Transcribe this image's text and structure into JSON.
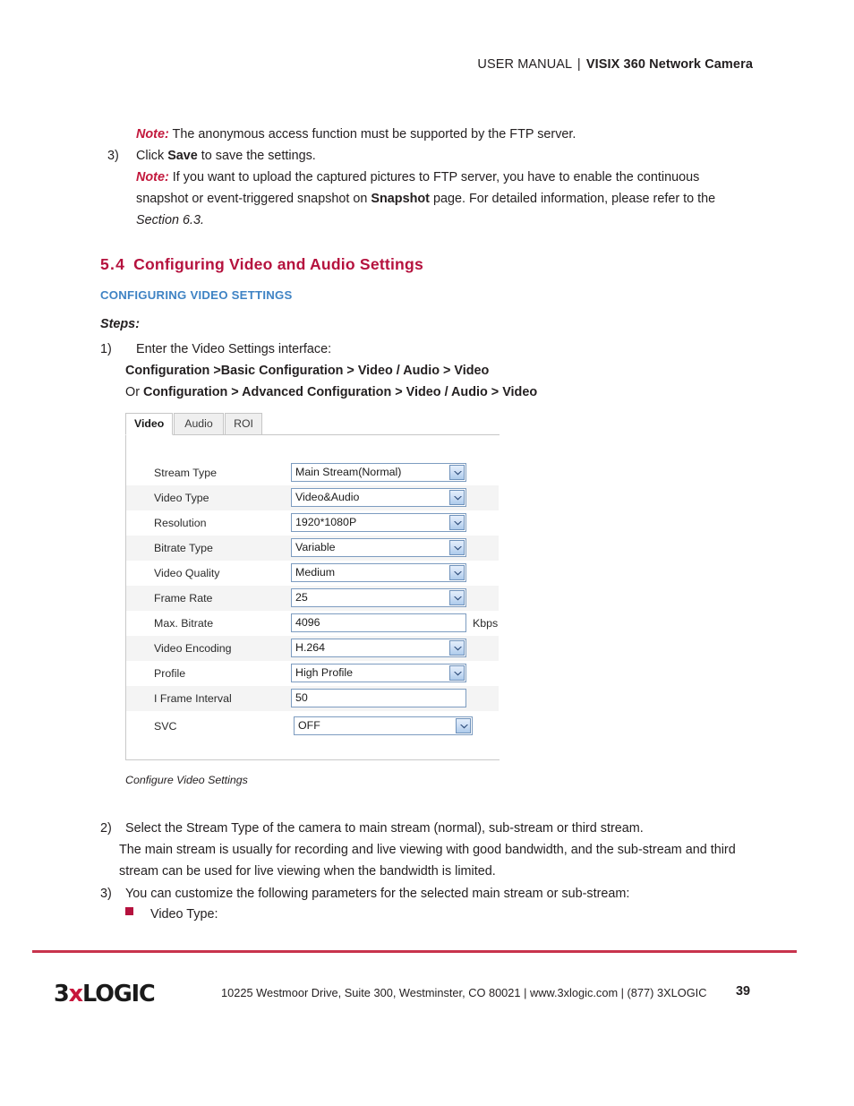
{
  "header": {
    "manual": "USER MANUAL",
    "separator": "|",
    "product": "VISIX 360 Network Camera"
  },
  "intro": {
    "note1_label": "Note:",
    "note1_text": "The anonymous access function must be supported by the FTP server.",
    "step3_num": "3)",
    "step3_pre": "Click ",
    "step3_bold": "Save",
    "step3_post": " to save the settings.",
    "note2_label": "Note:",
    "note2_line1": "If you want to upload the captured pictures to FTP server, you have to enable the continuous",
    "note2_line2_pre": "snapshot or event-triggered snapshot on ",
    "note2_line2_bold": "Snapshot",
    "note2_line2_post": " page. For detailed information, please refer to the",
    "note2_line3": "Section 6.3."
  },
  "section": {
    "number": "5.4",
    "title": "Configuring Video and Audio Settings",
    "subheading": "CONFIGURING VIDEO SETTINGS",
    "steps_label": "Steps:",
    "step1_num": "1)",
    "step1_text": "Enter the Video Settings interface:",
    "path1": "Configuration >Basic Configuration > Video / Audio > Video",
    "path2_prefix": "Or ",
    "path2": "Configuration > Advanced Configuration > Video / Audio > Video"
  },
  "camera_ui": {
    "tabs": [
      {
        "label": "Video",
        "active": true
      },
      {
        "label": "Audio",
        "active": false
      },
      {
        "label": "ROI",
        "active": false
      }
    ],
    "fields": [
      {
        "label": "Stream Type",
        "value": "Main Stream(Normal)",
        "control": "dropdown",
        "unit": ""
      },
      {
        "label": "Video Type",
        "value": "Video&Audio",
        "control": "dropdown",
        "unit": ""
      },
      {
        "label": "Resolution",
        "value": "1920*1080P",
        "control": "dropdown",
        "unit": ""
      },
      {
        "label": "Bitrate Type",
        "value": "Variable",
        "control": "dropdown",
        "unit": ""
      },
      {
        "label": "Video Quality",
        "value": "Medium",
        "control": "dropdown",
        "unit": ""
      },
      {
        "label": "Frame Rate",
        "value": "25",
        "control": "dropdown",
        "unit": ""
      },
      {
        "label": "Max. Bitrate",
        "value": "4096",
        "control": "text",
        "unit": "Kbps"
      },
      {
        "label": "Video Encoding",
        "value": "H.264",
        "control": "dropdown",
        "unit": ""
      },
      {
        "label": "Profile",
        "value": "High Profile",
        "control": "dropdown",
        "unit": ""
      },
      {
        "label": "I Frame Interval",
        "value": "50",
        "control": "text",
        "unit": ""
      },
      {
        "label": "SVC",
        "value": "OFF",
        "control": "dropdown",
        "unit": ""
      }
    ],
    "caption": "Configure Video Settings"
  },
  "steps_after": {
    "step2_num": "2)",
    "step2_line1": "Select the Stream Type of the camera to main stream (normal), sub-stream or third stream.",
    "step2_line2": "The main stream is usually for recording and live viewing with good bandwidth, and the sub-stream and third",
    "step2_line3": "stream can be used for live viewing when the bandwidth is limited.",
    "step3_num": "3)",
    "step3_line": "You can customize the following parameters for the selected main stream or sub-stream:",
    "bullet1": "Video Type:"
  },
  "footer": {
    "logo_part1": "3",
    "logo_x": "x",
    "logo_part2": "LOGIC",
    "address": "10225 Westmoor Drive, Suite 300, Westminster, CO 80021 | www.3xlogic.com | (877) 3XLOGIC",
    "page_number": "39"
  },
  "colors": {
    "accent_red": "#b5123e",
    "note_red": "#c2183c",
    "sub_blue": "#3f83c4",
    "footer_rule": "#c8334d"
  }
}
